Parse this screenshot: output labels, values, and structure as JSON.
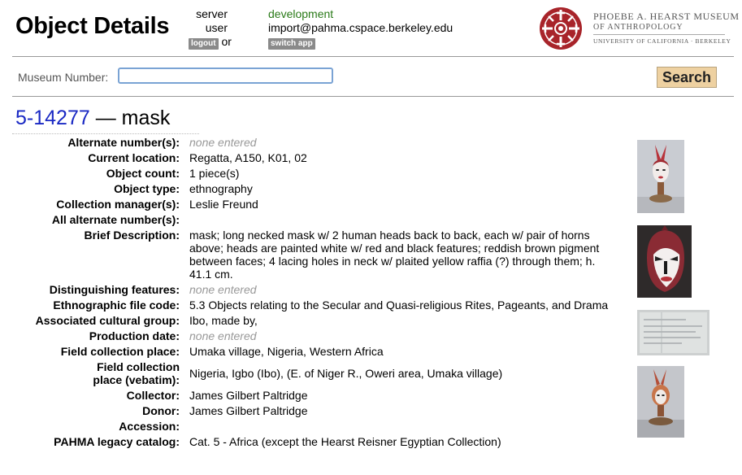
{
  "header": {
    "title": "Object Details",
    "server_label": "server",
    "server_value": "development",
    "user_label": "user",
    "user_value": "import@pahma.cspace.berkeley.edu",
    "logout_label": "logout",
    "or_text": "or",
    "switch_app_label": "switch app"
  },
  "museum": {
    "name": "PHOEBE A. HEARST MUSEUM",
    "subtitle": "OF ANTHROPOLOGY",
    "university": "UNIVERSITY OF CALIFORNIA · BERKELEY",
    "logo_color": "#a8242a"
  },
  "search": {
    "label": "Museum Number:",
    "value": "",
    "placeholder": "",
    "button_label": "Search"
  },
  "object": {
    "number": "5-14277",
    "separator": "—",
    "name": "mask"
  },
  "fields": [
    {
      "label": "Alternate number(s):",
      "value": "none entered",
      "empty": true
    },
    {
      "label": "Current location:",
      "value": "Regatta, A150, K01, 02",
      "empty": false
    },
    {
      "label": "Object count:",
      "value": "1 piece(s)",
      "empty": false
    },
    {
      "label": "Object type:",
      "value": "ethnography",
      "empty": false
    },
    {
      "label": "Collection manager(s):",
      "value": "Leslie Freund",
      "empty": false
    },
    {
      "label": "All alternate number(s):",
      "value": "",
      "empty": false
    },
    {
      "label": "Brief Description:",
      "value": "mask; long necked mask w/ 2 human heads back to back, each w/ pair of horns above; heads are painted white w/ red and black features; reddish brown pigment between faces; 4 lacing holes in neck w/ plaited yellow raffia (?) through them; h. 41.1 cm.",
      "empty": false
    },
    {
      "label": "Distinguishing features:",
      "value": "none entered",
      "empty": true
    },
    {
      "label": "Ethnographic file code:",
      "value": "5.3 Objects relating to the Secular and Quasi-religious Rites, Pageants, and Drama",
      "empty": false
    },
    {
      "label": "Associated cultural group:",
      "value": "Ibo, made by,",
      "empty": false
    },
    {
      "label": "Production date:",
      "value": "none entered",
      "empty": true
    },
    {
      "label": "Field collection place:",
      "value": "Umaka village, Nigeria, Western Africa",
      "empty": false
    },
    {
      "label": "Field collection place (vebatim):",
      "value": "Nigeria, Igbo (Ibo), (E. of Niger R., Oweri area, Umaka village)",
      "empty": false
    },
    {
      "label": "Collector:",
      "value": "James Gilbert Paltridge",
      "empty": false
    },
    {
      "label": "Donor:",
      "value": "James Gilbert Paltridge",
      "empty": false
    },
    {
      "label": "Accession:",
      "value": "",
      "empty": false
    },
    {
      "label": "PAHMA legacy catalog:",
      "value": "Cat. 5 - Africa (except the Hearst Reisner Egyptian Collection)",
      "empty": false
    }
  ]
}
